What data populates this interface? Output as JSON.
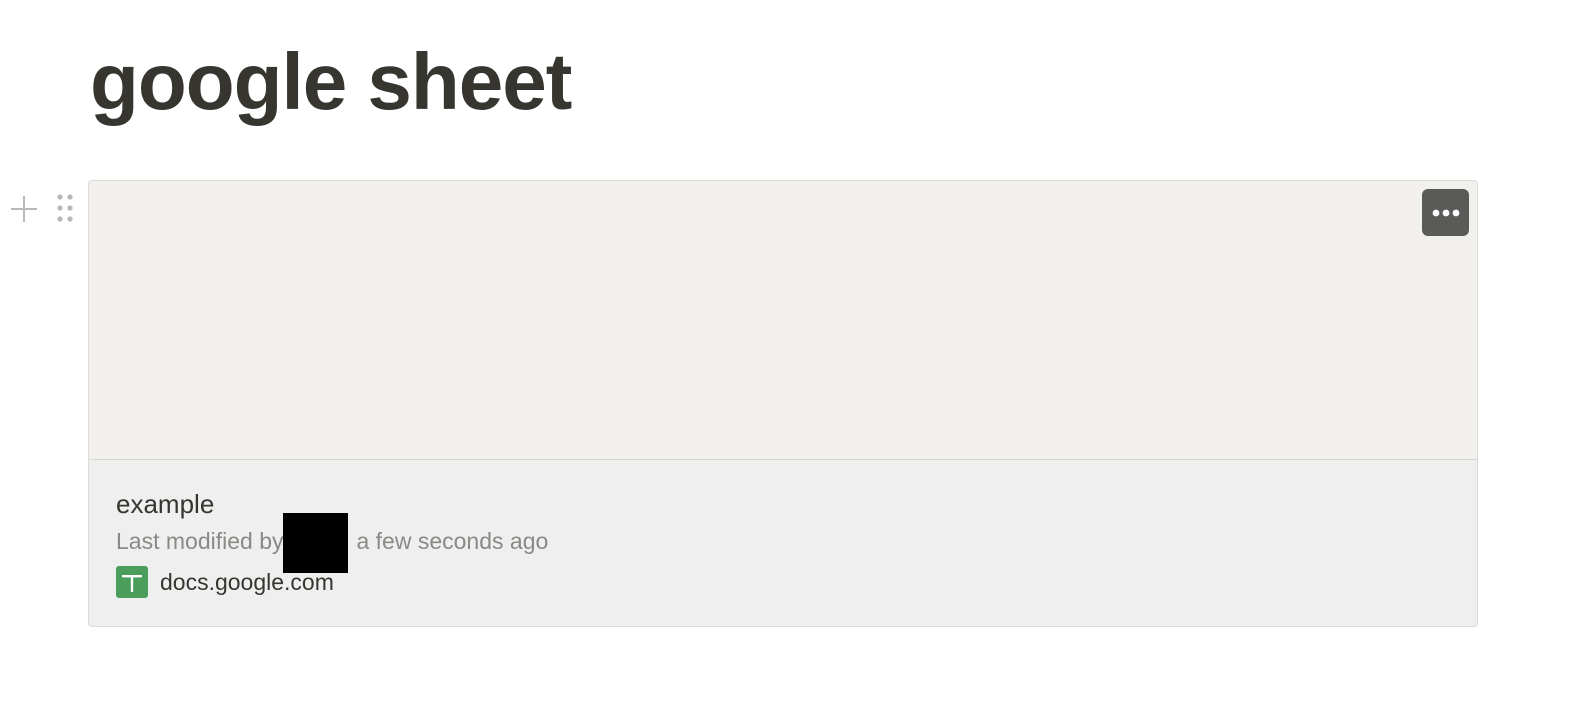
{
  "page": {
    "title": "google sheet"
  },
  "block_handles": {
    "add_icon": "plus-icon",
    "drag_icon": "drag-dots-icon"
  },
  "embed": {
    "more_icon": "more-horizontal-icon",
    "file_name": "example",
    "modified_prefix": "Last modified by",
    "modified_suffix": "a few seconds ago",
    "domain": "docs.google.com",
    "domain_icon": "google-sheets-icon",
    "colors": {
      "preview_bg": "#f1f0ec",
      "footer_bg": "#efefef",
      "sheets_green": "#4a9d5b",
      "more_button_bg": "#5a5a58"
    }
  }
}
